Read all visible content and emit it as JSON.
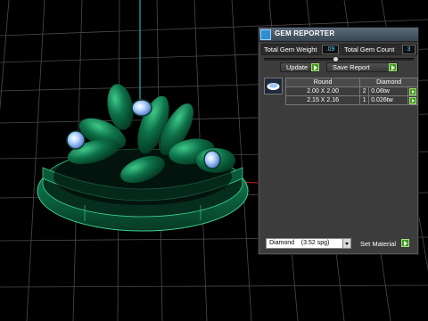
{
  "panel": {
    "title": "GEM REPORTER",
    "total_weight_label": "Total Gem Weight",
    "total_weight_value": ".09",
    "total_count_label": "Total Gem Count",
    "total_count_value": "3",
    "update_label": "Update",
    "save_report_label": "Save Report",
    "slider_fraction": 0.48
  },
  "table": {
    "headers": [
      "Round",
      "Diamond"
    ],
    "rows": [
      {
        "size": "2.00 X 2.00",
        "count": "2",
        "weight": "0.06tw"
      },
      {
        "size": "2.15 X 2.16",
        "count": "1",
        "weight": "0.026tw"
      }
    ]
  },
  "material": {
    "selected": "Diamond    (3.52 spg)",
    "set_label": "Set Material"
  },
  "colors": {
    "ring": "#0c6a44",
    "ring_highlight": "#2fb37a",
    "grid": "#4a4a4a",
    "gem": "#6aa8ff",
    "accent_cyan": "#4fd6ff",
    "button_green": "#3d9a1a"
  },
  "icons": {
    "title": "gem-reporter-icon",
    "gem_thumbnail": "round-diamond-icon"
  }
}
